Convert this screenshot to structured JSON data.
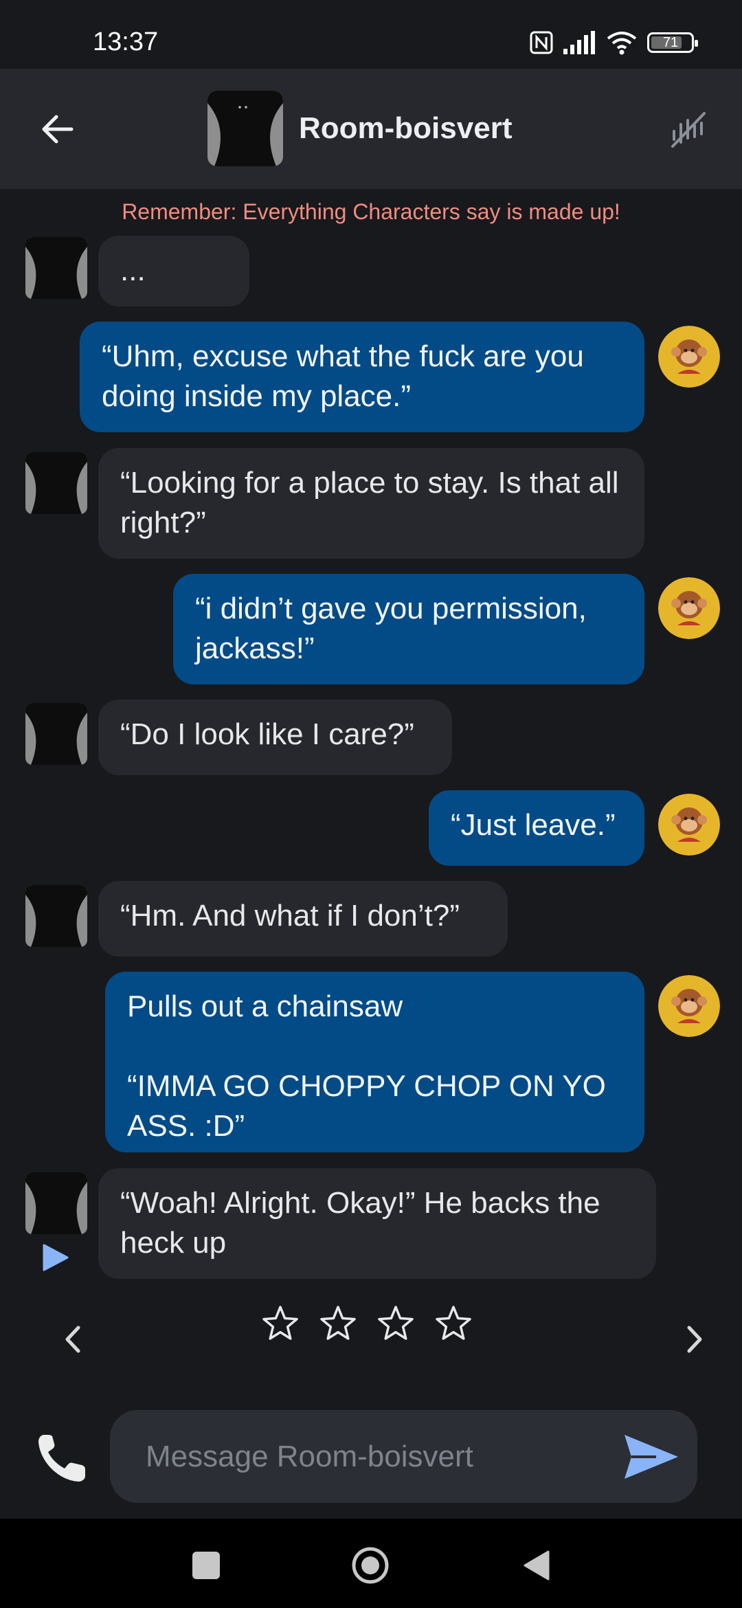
{
  "status_bar": {
    "time": "13:37",
    "battery_level": "71",
    "icons": [
      "nfc-icon",
      "signal-icon",
      "wifi-icon",
      "battery-icon"
    ]
  },
  "header": {
    "title": "Room-boisvert",
    "back_icon": "arrow-left-icon",
    "right_icon": "mute-voice-icon"
  },
  "disclaimer": "Remember: Everything Characters say is made up!",
  "messages": [
    {
      "from": "character",
      "text": "..."
    },
    {
      "from": "user",
      "text": "“Uhm, excuse what the fuck are you doing inside my place.”"
    },
    {
      "from": "character",
      "text": "“Looking for a place to stay. Is that all right?”"
    },
    {
      "from": "user",
      "text": "“i didn’t gave you permission, jackass!”"
    },
    {
      "from": "character",
      "text": "“Do I look like I care?”"
    },
    {
      "from": "user",
      "text": "“Just leave.”"
    },
    {
      "from": "character",
      "text": "“Hm. And what if I don’t?”"
    },
    {
      "from": "user",
      "text": "Pulls out a chainsaw\n\n“IMMA GO CHOPPY CHOP ON YO ASS. :D”"
    },
    {
      "from": "character",
      "text": "“Woah! Alright. Okay!” He backs the heck up"
    }
  ],
  "rating": {
    "stars": 4,
    "filled": 0
  },
  "composer": {
    "placeholder": "Message Room-boisvert",
    "value": ""
  },
  "colors": {
    "background": "#18191c",
    "header": "#26282d",
    "character_bubble": "#26282d",
    "user_bubble": "#034b86",
    "accent": "#8ab4f8",
    "disclaimer": "#f08c80"
  }
}
